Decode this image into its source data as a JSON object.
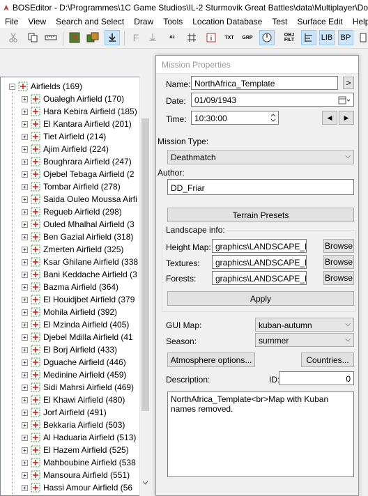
{
  "window": {
    "title": "BOSEditor - D:\\Programmes\\1C Game Studios\\IL-2 Sturmovik Great Battles\\data\\Multiplayer\\Do"
  },
  "menu": [
    "File",
    "View",
    "Search and Select",
    "Draw",
    "Tools",
    "Location Database",
    "Test",
    "Surface Edit",
    "Help"
  ],
  "toolbar": {
    "buttons": [
      "cut",
      "copy",
      "ruler",
      "map-green",
      "map-swap",
      "download",
      "F",
      "anchor",
      "AZ",
      "grid",
      "info",
      "TXT",
      "GRP",
      "compass",
      "OBJ FILT",
      "bars",
      "LIB",
      "BP"
    ]
  },
  "tree": {
    "root": "Airfields (169)",
    "items": [
      "Oualegh Airfield (170)",
      "Hara Kebira Airfield (185)",
      "El Kantara Airfield (201)",
      "Tiet Airfield (214)",
      "Ajim Airfield (224)",
      "Boughrara Airfield (247)",
      "Ojebel Tebaga Airfield (2",
      "Tombar Airfield (278)",
      "Saida Ouleo Moussa Airfi",
      "Regueb Airfield (298)",
      "Ouled Mhalhal Airfield (3",
      "Ben Gazial Airfield (318)",
      "Zmerten Airfield (325)",
      "Ksar Ghilane Airfield (338",
      "Bani Keddache Airfield (3",
      "Bazma Airfield (364)",
      "El Houidjbet Airfield (379",
      "Mohila Airfield (392)",
      "El Mzinda Airfield (405)",
      "Djebel Mdilla Airfield (41",
      "El Borj Airfield (433)",
      "Dguache Airfield (446)",
      "Medinine Airfield (459)",
      "Sidi Mahrsi Airfield (469)",
      "El Khawi Airfield (480)",
      "Jorf Airfield (491)",
      "Bekkaria Airfield (503)",
      "Al Haduaria Airfield (513)",
      "El Hazem Airfield (525)",
      "Mahboubine Airfield (538",
      "Mansoura Airfield (551)",
      "Hassi Amour Airfield (56"
    ]
  },
  "dialog": {
    "title": "Mission Properties",
    "name_label": "Name:",
    "name_value": "NorthAfrica_Template",
    "name_btn": ">",
    "date_label": "Date:",
    "date_value": "01/09/1943",
    "time_label": "Time:",
    "time_value": "10:30:00",
    "mission_type_label": "Mission Type:",
    "mission_type_value": "Deathmatch",
    "author_label": "Author:",
    "author_value": "DD_Friar",
    "terrain_presets": "Terrain Presets",
    "landscape_label": "Landscape info:",
    "height_map_label": "Height Map:",
    "height_map_value": "graphics\\LANDSCAPE_Kuba",
    "textures_label": "Textures:",
    "textures_value": "graphics\\LANDSCAPE_Kuba",
    "forests_label": "Forests:",
    "forests_value": "graphics\\LANDSCAPE_Kuba",
    "browse": "Browse",
    "apply": "Apply",
    "gui_map_label": "GUI Map:",
    "gui_map_value": "kuban-autumn",
    "season_label": "Season:",
    "season_value": "summer",
    "atmosphere_btn": "Atmosphere options...",
    "countries_btn": "Countries...",
    "description_label": "Description:",
    "id_label": "ID:",
    "id_value": "0",
    "description_value": "NorthAfrica_Template<br>Map with Kuban names removed."
  },
  "colors": {
    "accent": "#cce4f7",
    "node_green": "#2e9e2e",
    "node_red": "#d01010"
  }
}
